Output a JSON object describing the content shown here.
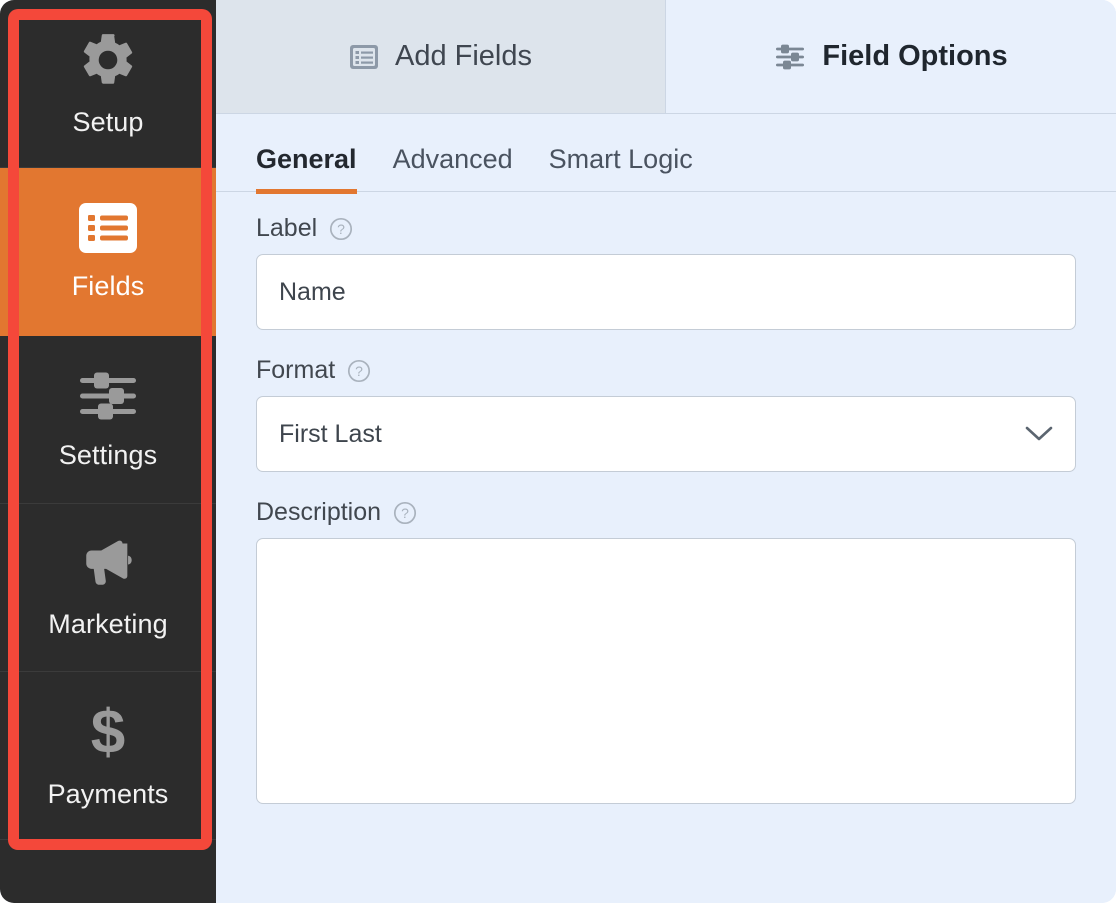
{
  "sidebar": {
    "items": [
      {
        "label": "Setup",
        "icon": "gear-icon",
        "active": false
      },
      {
        "label": "Fields",
        "icon": "list-icon",
        "active": true
      },
      {
        "label": "Settings",
        "icon": "sliders-icon",
        "active": false
      },
      {
        "label": "Marketing",
        "icon": "megaphone-icon",
        "active": false
      },
      {
        "label": "Payments",
        "icon": "dollar-icon",
        "active": false
      }
    ]
  },
  "highlight": {
    "color": "#f4483a"
  },
  "top_tabs": [
    {
      "label": "Add Fields",
      "icon": "list-panel-icon",
      "active": false
    },
    {
      "label": "Field Options",
      "icon": "sliders-icon",
      "active": true
    }
  ],
  "sub_tabs": [
    {
      "label": "General",
      "active": true
    },
    {
      "label": "Advanced",
      "active": false
    },
    {
      "label": "Smart Logic",
      "active": false
    }
  ],
  "form": {
    "label_field": {
      "label": "Label",
      "value": "Name",
      "placeholder": ""
    },
    "format_field": {
      "label": "Format",
      "value": "First Last"
    },
    "description_field": {
      "label": "Description",
      "value": "",
      "placeholder": ""
    }
  },
  "colors": {
    "accent_orange": "#e27730",
    "sidebar_dark": "#2c2c2c",
    "panel_bg": "#e8f0fc",
    "inactive_tab_bg": "#dde4ec",
    "highlight_red": "#f4483a"
  }
}
